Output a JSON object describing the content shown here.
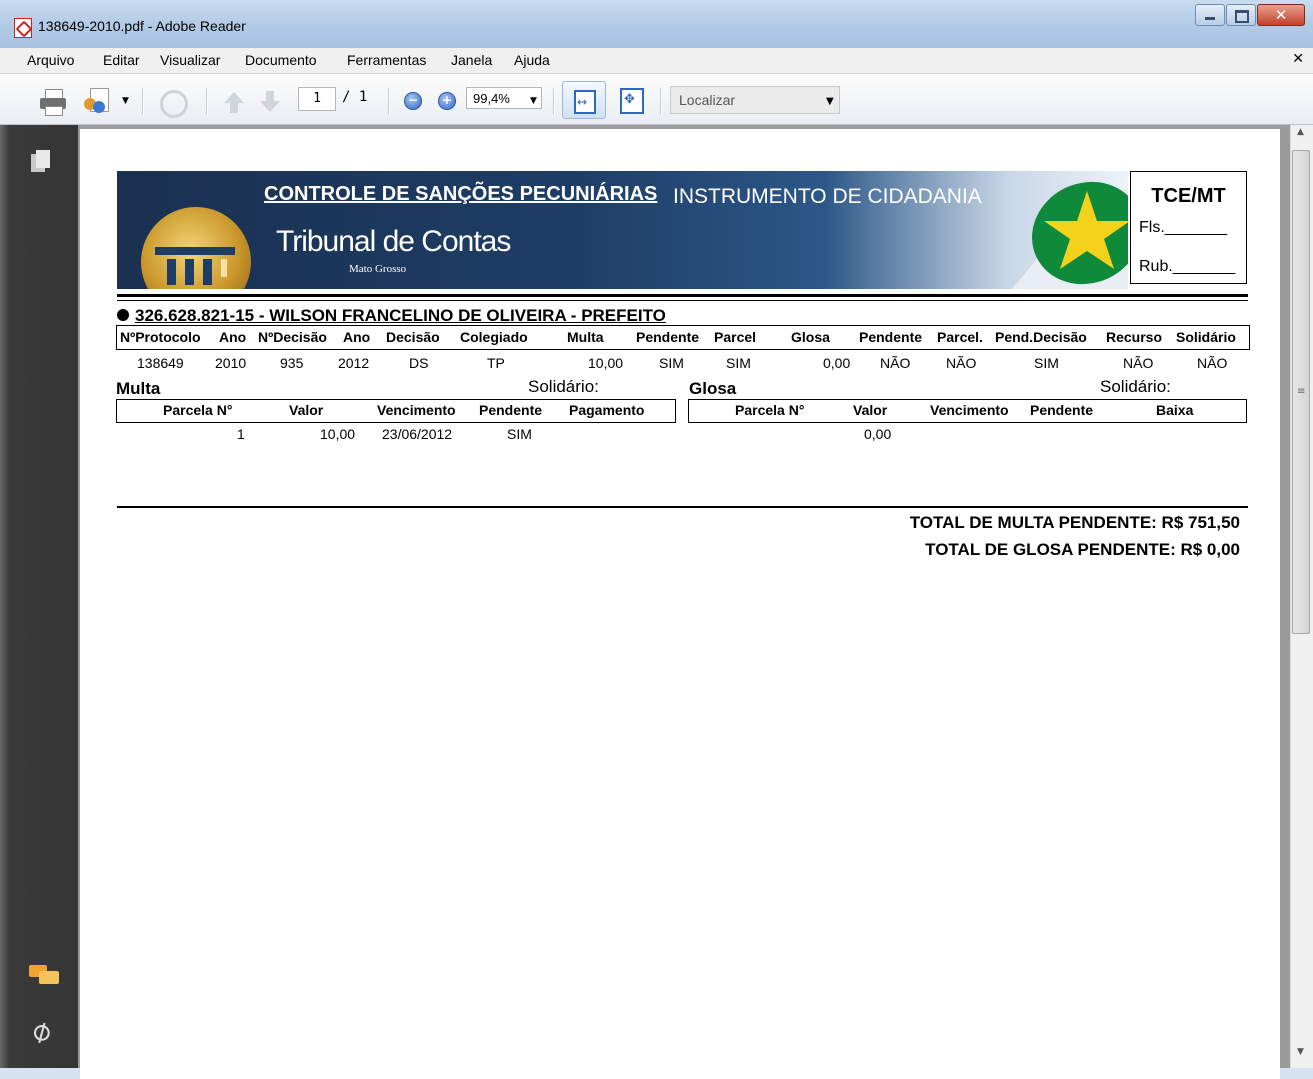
{
  "window": {
    "title": "138649-2010.pdf - Adobe Reader"
  },
  "menu": [
    "Arquivo",
    "Editar",
    "Visualizar",
    "Documento",
    "Ferramentas",
    "Janela",
    "Ajuda"
  ],
  "toolbar": {
    "page_current": "1",
    "page_total": "/ 1",
    "zoom": "99,4%",
    "find_placeholder": "Localizar",
    "zoom_out": "−",
    "zoom_in": "+"
  },
  "banner": {
    "heading": "CONTROLE DE SANÇÕES PECUNIÁRIAS",
    "subheading": "INSTRUMENTO DE CIDADANIA",
    "org": "Tribunal de Contas",
    "state": "Mato Grosso"
  },
  "stamp": {
    "title": "TCE/MT",
    "fls": "Fls._______",
    "rub": "Rub._______"
  },
  "record": {
    "title": "326.628.821-15 - WILSON FRANCELINO DE OLIVEIRA - PREFEITO",
    "columns": [
      "NºProtocolo",
      "Ano",
      "NºDecisão",
      "Ano",
      "Decisão",
      "Colegiado",
      "Multa",
      "Pendente",
      "Parcel",
      "Glosa",
      "Pendente",
      "Parcel.",
      "Pend.Decisão",
      "Recurso",
      "Solidário"
    ],
    "values": [
      "138649",
      "2010",
      "935",
      "2012",
      "DS",
      "TP",
      "10,00",
      "SIM",
      "SIM",
      "0,00",
      "NÃO",
      "NÃO",
      "SIM",
      "NÃO",
      "NÃO"
    ]
  },
  "multa": {
    "label": "Multa",
    "solidario": "Solidário:",
    "columns": [
      "Parcela N°",
      "Valor",
      "Vencimento",
      "Pendente",
      "Pagamento"
    ],
    "row": [
      "1",
      "10,00",
      "23/06/2012",
      "SIM",
      ""
    ]
  },
  "glosa": {
    "label": "Glosa",
    "solidario": "Solidário:",
    "columns": [
      "Parcela N°",
      "Valor",
      "Vencimento",
      "Pendente",
      "Baixa"
    ],
    "row": [
      "",
      "0,00",
      "",
      "",
      ""
    ]
  },
  "totals": {
    "multa": "TOTAL DE MULTA PENDENTE: R$ 751,50",
    "glosa": "TOTAL DE GLOSA PENDENTE: R$ 0,00"
  }
}
